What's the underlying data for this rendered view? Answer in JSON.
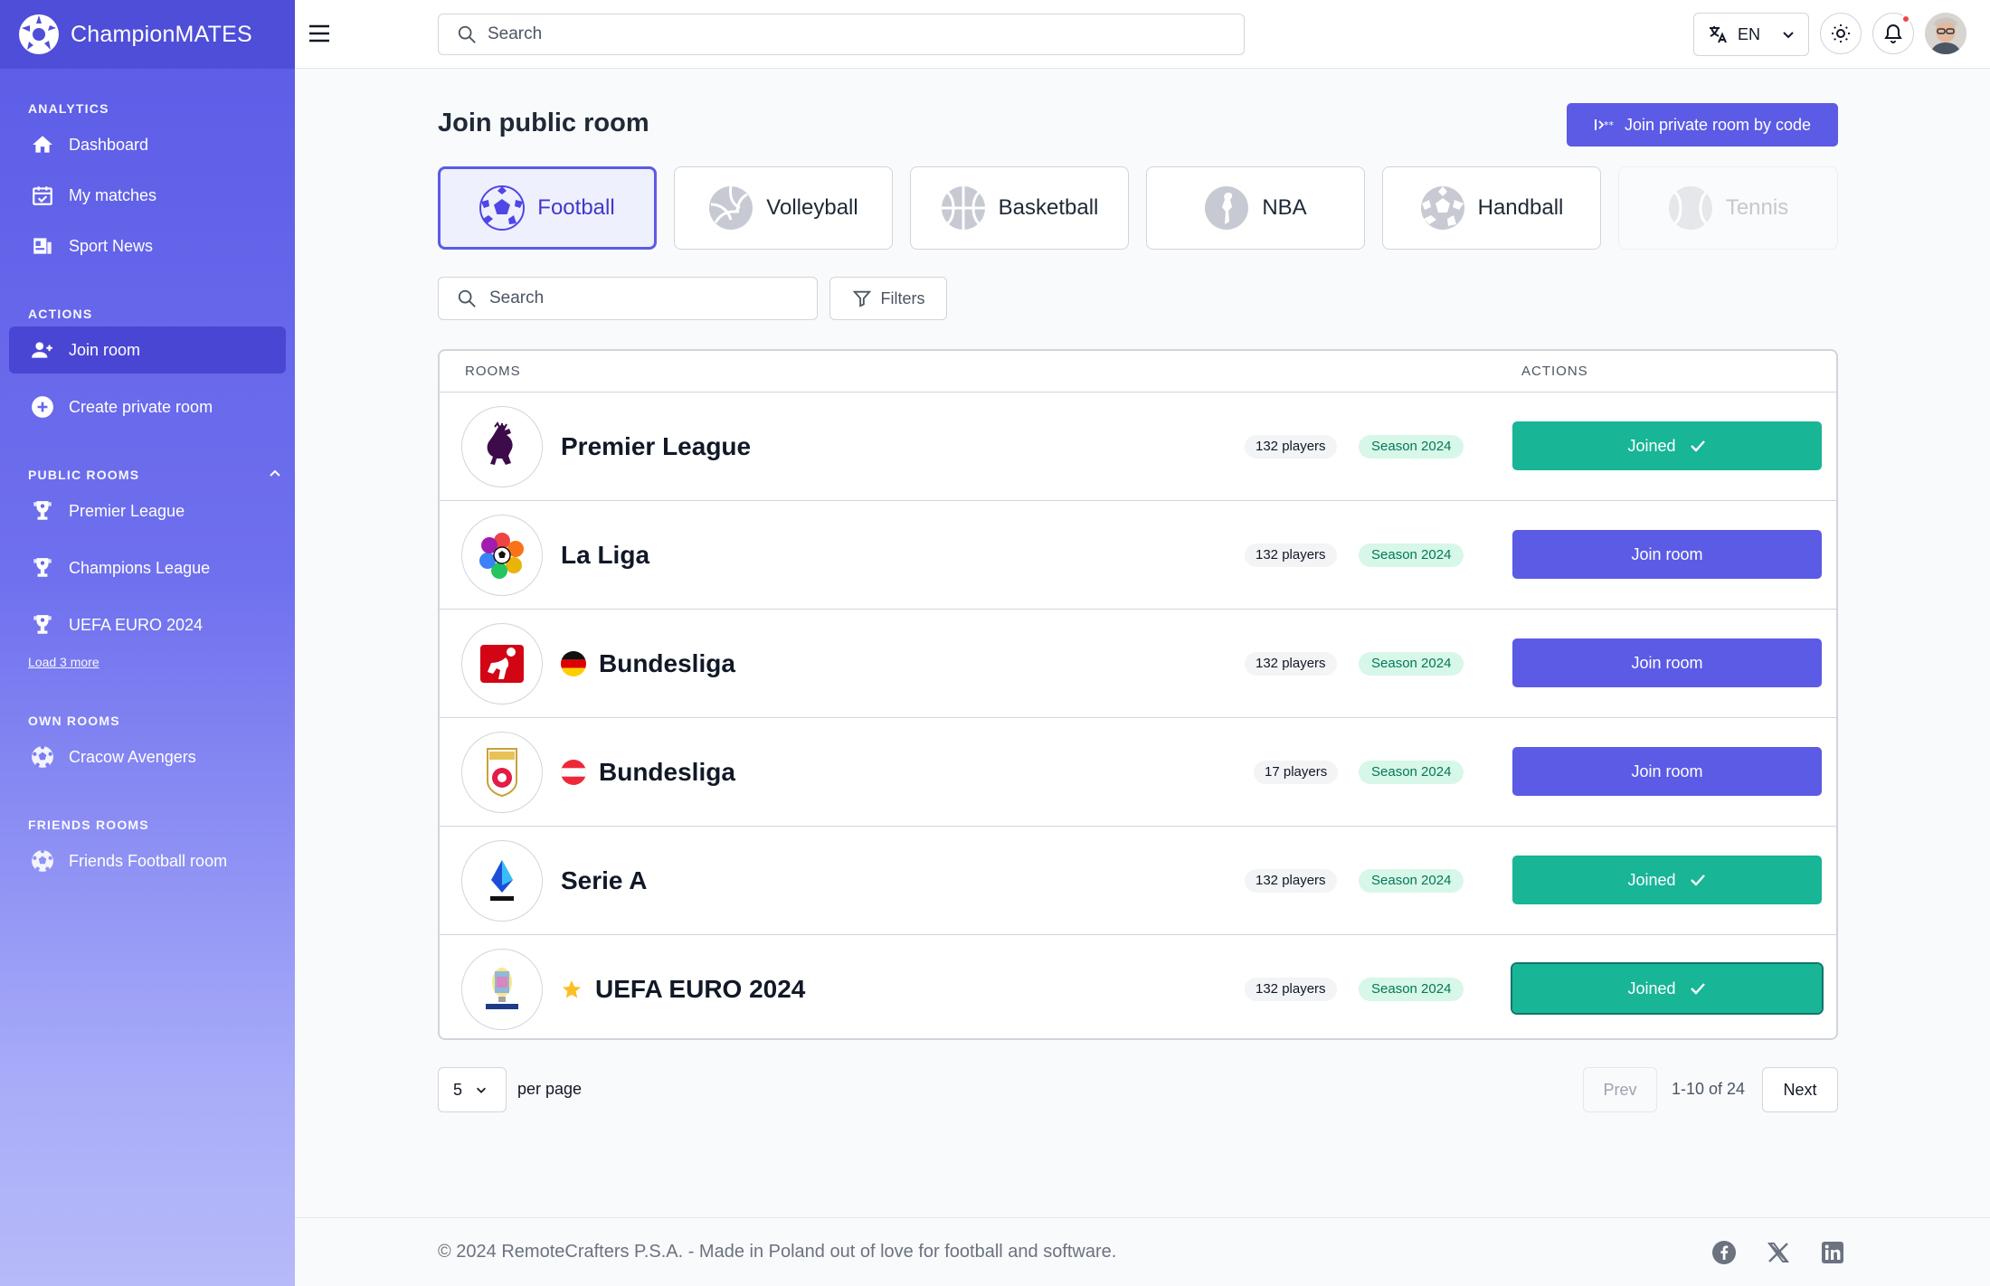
{
  "app": {
    "name": "ChampionMATES"
  },
  "sidebar": {
    "analytics_label": "ANALYTICS",
    "analytics": [
      {
        "label": "Dashboard",
        "icon": "home-icon"
      },
      {
        "label": "My matches",
        "icon": "calendar-icon"
      },
      {
        "label": "Sport News",
        "icon": "news-icon"
      }
    ],
    "actions_label": "ACTIONS",
    "actions": [
      {
        "label": "Join room",
        "icon": "user-plus-icon",
        "active": true
      },
      {
        "label": "Create private room",
        "icon": "plus-circle-icon"
      }
    ],
    "public_label": "PUBLIC ROOMS",
    "public": [
      {
        "label": "Premier League",
        "icon": "trophy-icon"
      },
      {
        "label": "Champions League",
        "icon": "trophy-icon"
      },
      {
        "label": "UEFA EURO 2024",
        "icon": "trophy-icon"
      }
    ],
    "load_more": "Load 3 more",
    "own_label": "OWN ROOMS",
    "own": [
      {
        "label": "Cracow Avengers",
        "icon": "football-icon"
      }
    ],
    "friends_label": "FRIENDS ROOMS",
    "friends": [
      {
        "label": "Friends Football room",
        "icon": "football-icon"
      }
    ]
  },
  "topbar": {
    "search_placeholder": "Search",
    "language": "EN"
  },
  "page": {
    "title": "Join public room",
    "join_code_button": "Join private room by code",
    "tabs": [
      {
        "label": "Football",
        "icon": "football-icon",
        "active": true
      },
      {
        "label": "Volleyball",
        "icon": "volleyball-icon"
      },
      {
        "label": "Basketball",
        "icon": "basketball-icon"
      },
      {
        "label": "NBA",
        "icon": "nba-icon"
      },
      {
        "label": "Handball",
        "icon": "handball-icon"
      },
      {
        "label": "Tennis",
        "icon": "tennis-icon",
        "disabled": true
      }
    ],
    "search_placeholder": "Search",
    "filters_label": "Filters"
  },
  "table": {
    "col_rooms": "ROOMS",
    "col_actions": "ACTIONS",
    "rows": [
      {
        "name": "Premier League",
        "logo": "premier-league-logo",
        "players": "132 players",
        "season": "Season 2024",
        "action": "Joined",
        "joined": true
      },
      {
        "name": "La Liga",
        "logo": "la-liga-logo",
        "players": "132 players",
        "season": "Season 2024",
        "action": "Join room",
        "joined": false
      },
      {
        "name": "Bundesliga",
        "logo": "bundesliga-logo",
        "flag": "germany-flag",
        "players": "132 players",
        "season": "Season 2024",
        "action": "Join room",
        "joined": false
      },
      {
        "name": "Bundesliga",
        "logo": "austrian-bundesliga-logo",
        "flag": "austria-flag",
        "players": "17 players",
        "season": "Season 2024",
        "action": "Join room",
        "joined": false
      },
      {
        "name": "Serie A",
        "logo": "serie-a-logo",
        "players": "132 players",
        "season": "Season 2024",
        "action": "Joined",
        "joined": true
      },
      {
        "name": "UEFA EURO 2024",
        "logo": "euro-2024-logo",
        "star": true,
        "players": "132 players",
        "season": "Season 2024",
        "action": "Joined",
        "joined": true
      }
    ]
  },
  "pagination": {
    "per_page_value": "5",
    "per_page_label": "per page",
    "prev": "Prev",
    "range": "1-10 of 24",
    "next": "Next"
  },
  "footer": {
    "copyright": "© 2024 RemoteCrafters P.S.A. - Made in Poland out of love for football and software."
  },
  "colors": {
    "accent": "#5b5be6",
    "joined": "#18b597",
    "season_bg": "#d7f7e9"
  }
}
